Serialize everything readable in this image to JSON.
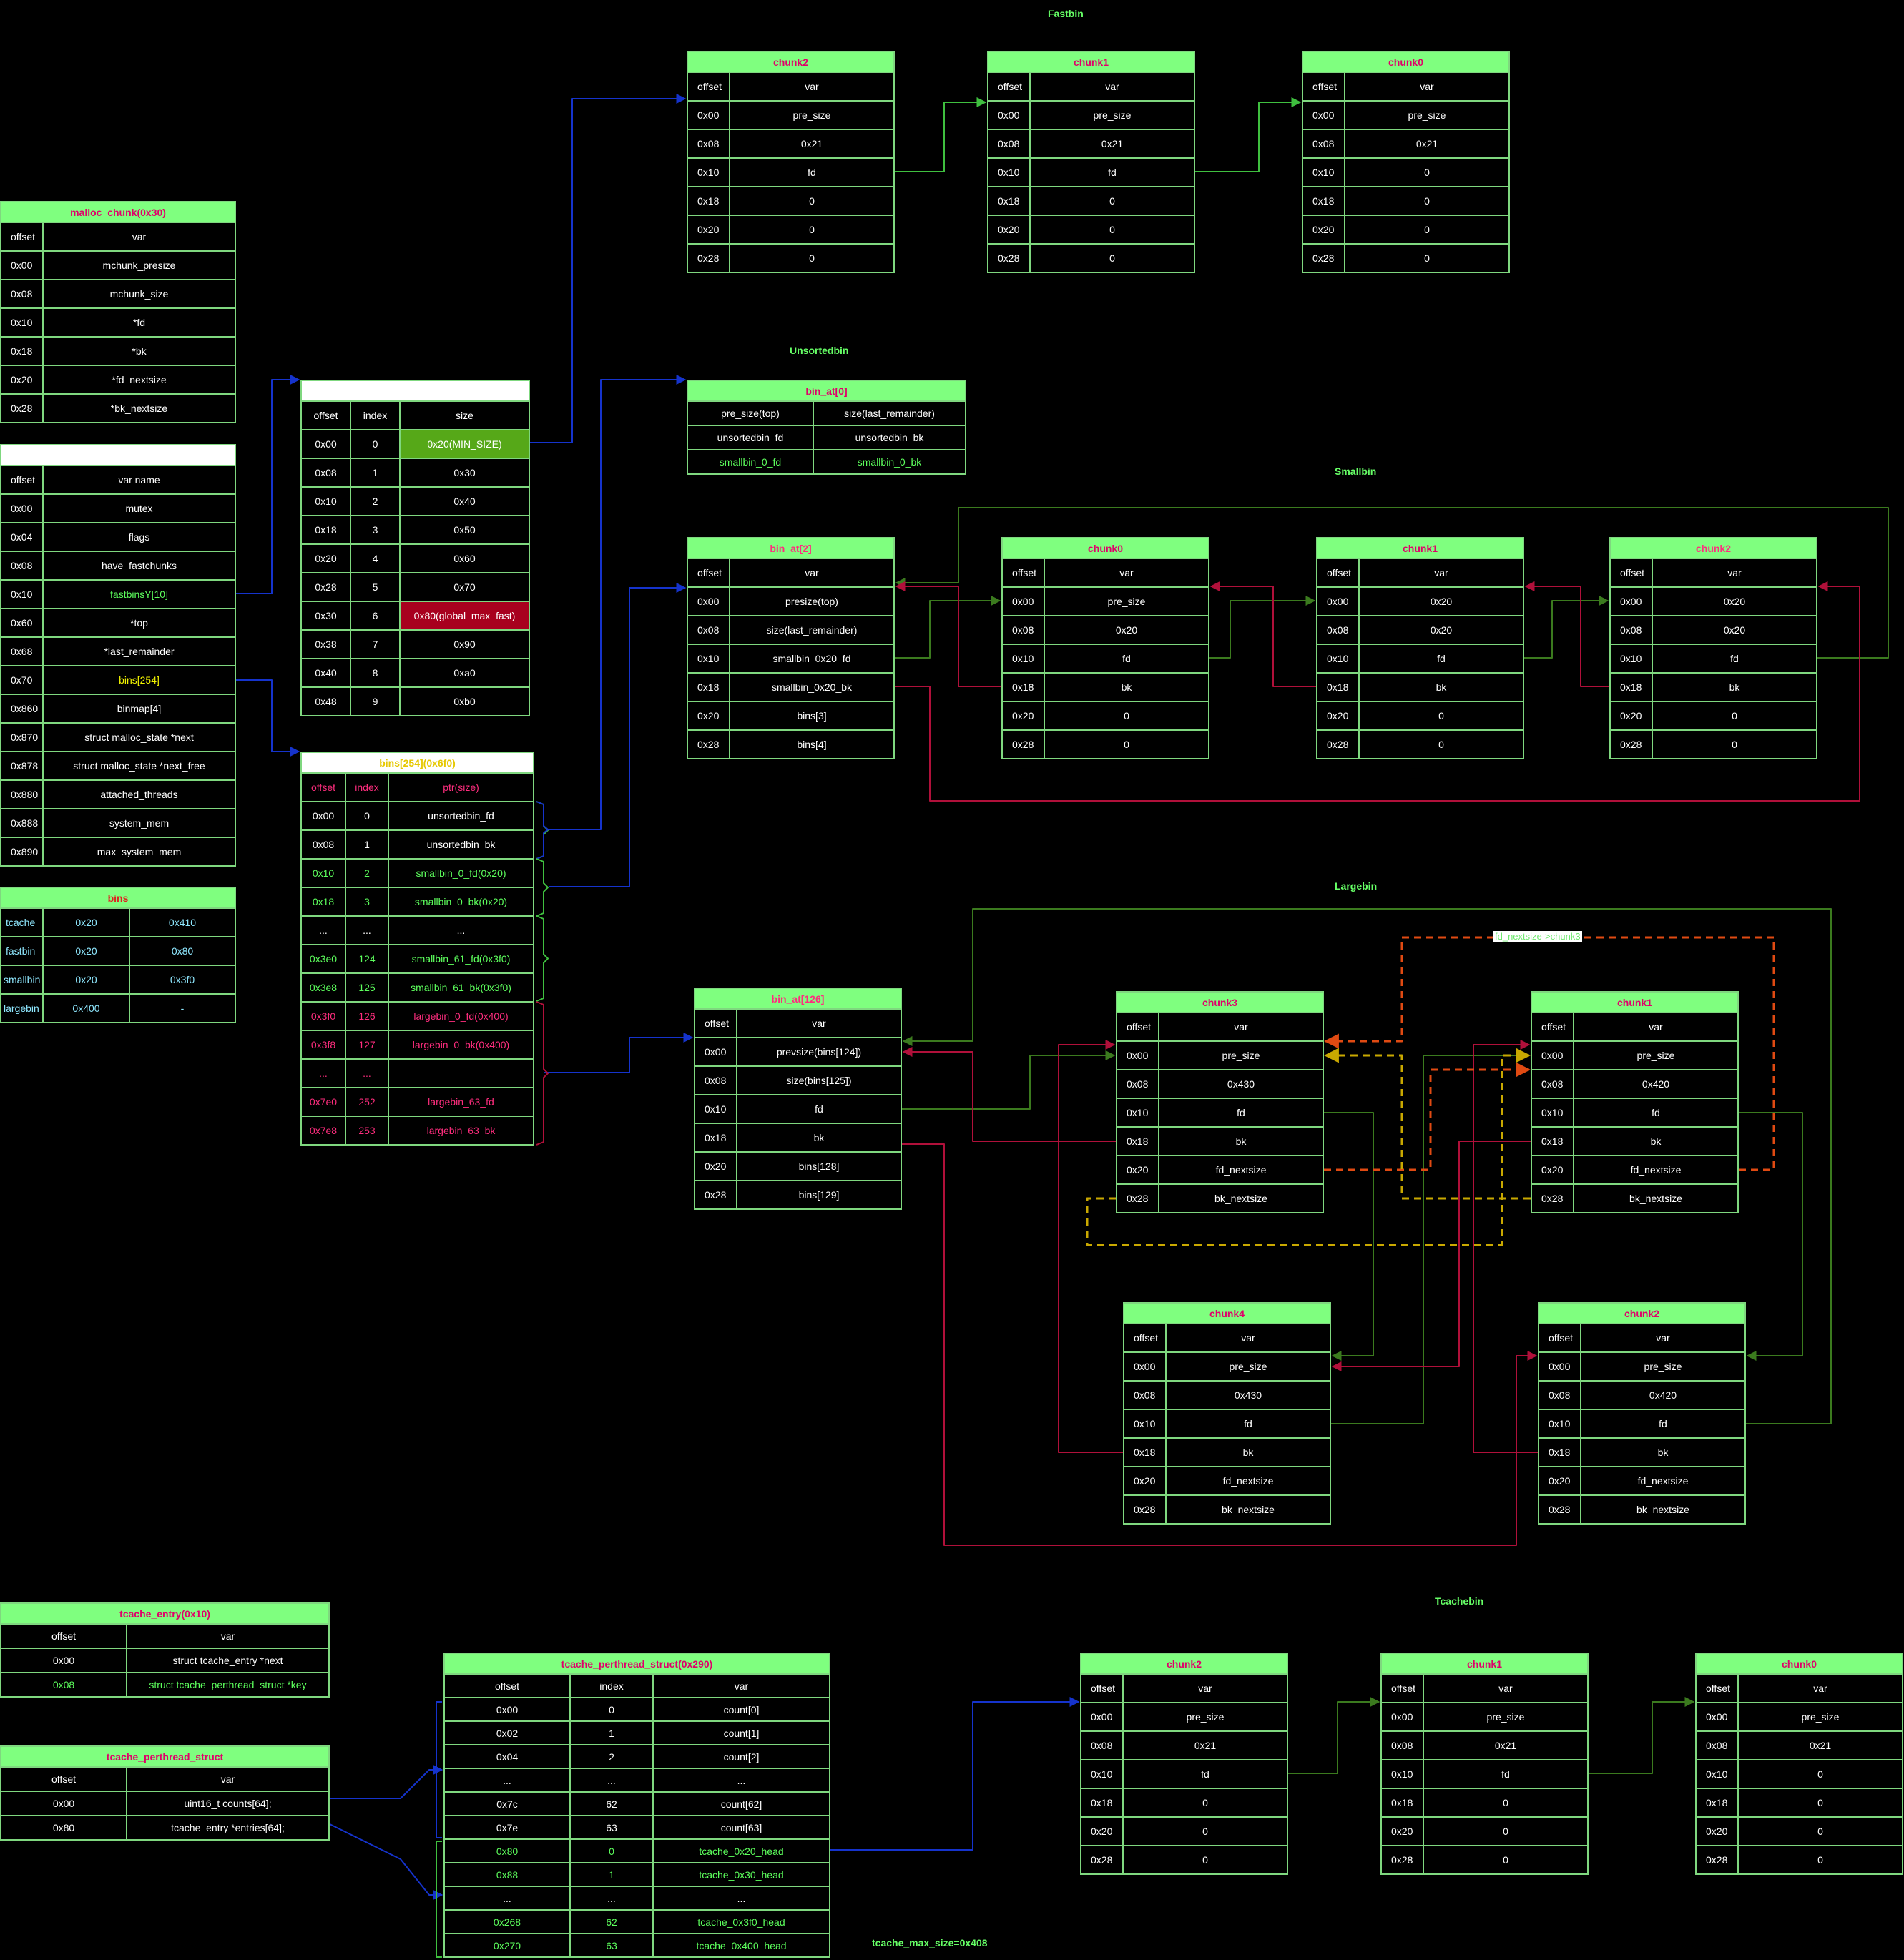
{
  "section_titles": {
    "fastbin": "Fastbin",
    "unsortedbin": "Unsortedbin",
    "smallbin": "Smallbin",
    "largebin": "Largebin",
    "tcachebin": "Tcachebin",
    "tcache_max_size": "tcache_max_size=0x408"
  },
  "notes": {
    "fd_nextsize_chunk3": "fd_nextsize->chunk3"
  },
  "malloc_chunk": {
    "title": "malloc_chunk(0x30)",
    "header": [
      "offset",
      "var"
    ],
    "rows": [
      [
        "0x00",
        "mchunk_presize"
      ],
      [
        "0x08",
        "mchunk_size"
      ],
      [
        "0x10",
        "*fd"
      ],
      [
        "0x18",
        "*bk"
      ],
      [
        "0x20",
        "*fd_nextsize"
      ],
      [
        "0x28",
        "*bk_nextsize"
      ]
    ]
  },
  "malloc_state": {
    "title": "",
    "header": [
      "offset",
      "var name"
    ],
    "rows": [
      [
        "0x00",
        "mutex"
      ],
      [
        "0x04",
        "flags"
      ],
      [
        "0x08",
        "have_fastchunks"
      ],
      [
        "0x10",
        "fastbinsY[10]"
      ],
      [
        "0x60",
        "*top"
      ],
      [
        "0x68",
        "*last_remainder"
      ],
      [
        "0x70",
        "bins[254]"
      ],
      [
        "0x860",
        "binmap[4]"
      ],
      [
        "0x870",
        "struct malloc_state *next"
      ],
      [
        "0x878",
        "struct malloc_state *next_free"
      ],
      [
        "0x880",
        "attached_threads"
      ],
      [
        "0x888",
        "system_mem"
      ],
      [
        "0x890",
        "max_system_mem"
      ]
    ]
  },
  "bins_summary": {
    "title": "bins",
    "rows": [
      [
        "tcache",
        "0x20",
        "0x410"
      ],
      [
        "fastbin",
        "0x20",
        "0x80"
      ],
      [
        "smallbin",
        "0x20",
        "0x3f0"
      ],
      [
        "largebin",
        "0x400",
        "-"
      ]
    ]
  },
  "fastbins_y": {
    "title": "",
    "header": [
      "offset",
      "index",
      "size"
    ],
    "rows": [
      [
        "0x00",
        "0",
        "0x20(MIN_SIZE)"
      ],
      [
        "0x08",
        "1",
        "0x30"
      ],
      [
        "0x10",
        "2",
        "0x40"
      ],
      [
        "0x18",
        "3",
        "0x50"
      ],
      [
        "0x20",
        "4",
        "0x60"
      ],
      [
        "0x28",
        "5",
        "0x70"
      ],
      [
        "0x30",
        "6",
        "0x80(global_max_fast)"
      ],
      [
        "0x38",
        "7",
        "0x90"
      ],
      [
        "0x40",
        "8",
        "0xa0"
      ],
      [
        "0x48",
        "9",
        "0xb0"
      ]
    ]
  },
  "bins_array": {
    "title": "bins[254](0x6f0)",
    "header": [
      "offset",
      "index",
      "ptr(size)"
    ],
    "rows": [
      [
        "0x00",
        "0",
        "unsortedbin_fd"
      ],
      [
        "0x08",
        "1",
        "unsortedbin_bk"
      ],
      [
        "0x10",
        "2",
        "smallbin_0_fd(0x20)"
      ],
      [
        "0x18",
        "3",
        "smallbin_0_bk(0x20)"
      ],
      [
        "...",
        "...",
        "..."
      ],
      [
        "0x3e0",
        "124",
        "smallbin_61_fd(0x3f0)"
      ],
      [
        "0x3e8",
        "125",
        "smallbin_61_bk(0x3f0)"
      ],
      [
        "0x3f0",
        "126",
        "largebin_0_fd(0x400)"
      ],
      [
        "0x3f8",
        "127",
        "largebin_0_bk(0x400)"
      ],
      [
        "...",
        "...",
        ""
      ],
      [
        "0x7e0",
        "252",
        "largebin_63_fd"
      ],
      [
        "0x7e8",
        "253",
        "largebin_63_bk"
      ]
    ]
  },
  "fast_chunks": [
    {
      "title": "chunk2",
      "rows": [
        [
          "0x00",
          "pre_size"
        ],
        [
          "0x08",
          "0x21"
        ],
        [
          "0x10",
          "fd"
        ],
        [
          "0x18",
          "0"
        ],
        [
          "0x20",
          "0"
        ],
        [
          "0x28",
          "0"
        ]
      ]
    },
    {
      "title": "chunk1",
      "rows": [
        [
          "0x00",
          "pre_size"
        ],
        [
          "0x08",
          "0x21"
        ],
        [
          "0x10",
          "fd"
        ],
        [
          "0x18",
          "0"
        ],
        [
          "0x20",
          "0"
        ],
        [
          "0x28",
          "0"
        ]
      ]
    },
    {
      "title": "chunk0",
      "rows": [
        [
          "0x00",
          "pre_size"
        ],
        [
          "0x08",
          "0x21"
        ],
        [
          "0x10",
          "0"
        ],
        [
          "0x18",
          "0"
        ],
        [
          "0x20",
          "0"
        ],
        [
          "0x28",
          "0"
        ]
      ]
    }
  ],
  "unsorted_bin_at": {
    "title": "bin_at[0]",
    "rows": [
      [
        "pre_size(top)",
        "size(last_remainder)"
      ],
      [
        "unsortedbin_fd",
        "unsortedbin_bk"
      ],
      [
        "smallbin_0_fd",
        "smallbin_0_bk"
      ]
    ]
  },
  "small_bin_at": {
    "title": "bin_at[2]",
    "rows": [
      [
        "0x00",
        "presize(top)"
      ],
      [
        "0x08",
        "size(last_remainder)"
      ],
      [
        "0x10",
        "smallbin_0x20_fd"
      ],
      [
        "0x18",
        "smallbin_0x20_bk"
      ],
      [
        "0x20",
        "bins[3]"
      ],
      [
        "0x28",
        "bins[4]"
      ]
    ]
  },
  "small_chunks": [
    {
      "title": "chunk0",
      "rows": [
        [
          "0x00",
          "pre_size"
        ],
        [
          "0x08",
          "0x20"
        ],
        [
          "0x10",
          "fd"
        ],
        [
          "0x18",
          "bk"
        ],
        [
          "0x20",
          "0"
        ],
        [
          "0x28",
          "0"
        ]
      ]
    },
    {
      "title": "chunk1",
      "rows": [
        [
          "0x00",
          "0x20"
        ],
        [
          "0x08",
          "0x20"
        ],
        [
          "0x10",
          "fd"
        ],
        [
          "0x18",
          "bk"
        ],
        [
          "0x20",
          "0"
        ],
        [
          "0x28",
          "0"
        ]
      ]
    },
    {
      "title": "chunk2",
      "rows": [
        [
          "0x00",
          "0x20"
        ],
        [
          "0x08",
          "0x20"
        ],
        [
          "0x10",
          "fd"
        ],
        [
          "0x18",
          "bk"
        ],
        [
          "0x20",
          "0"
        ],
        [
          "0x28",
          "0"
        ]
      ]
    }
  ],
  "large_bin_at": {
    "title": "bin_at[126]",
    "rows": [
      [
        "0x00",
        "prevsize(bins[124])"
      ],
      [
        "0x08",
        "size(bins[125])"
      ],
      [
        "0x10",
        "fd"
      ],
      [
        "0x18",
        "bk"
      ],
      [
        "0x20",
        "bins[128]"
      ],
      [
        "0x28",
        "bins[129]"
      ]
    ]
  },
  "large_chunks": {
    "chunk3": {
      "title": "chunk3",
      "rows": [
        [
          "0x00",
          "pre_size"
        ],
        [
          "0x08",
          "0x430"
        ],
        [
          "0x10",
          "fd"
        ],
        [
          "0x18",
          "bk"
        ],
        [
          "0x20",
          "fd_nextsize"
        ],
        [
          "0x28",
          "bk_nextsize"
        ]
      ]
    },
    "chunk1": {
      "title": "chunk1",
      "rows": [
        [
          "0x00",
          "pre_size"
        ],
        [
          "0x08",
          "0x420"
        ],
        [
          "0x10",
          "fd"
        ],
        [
          "0x18",
          "bk"
        ],
        [
          "0x20",
          "fd_nextsize"
        ],
        [
          "0x28",
          "bk_nextsize"
        ]
      ]
    },
    "chunk4": {
      "title": "chunk4",
      "rows": [
        [
          "0x00",
          "pre_size"
        ],
        [
          "0x08",
          "0x430"
        ],
        [
          "0x10",
          "fd"
        ],
        [
          "0x18",
          "bk"
        ],
        [
          "0x20",
          "fd_nextsize"
        ],
        [
          "0x28",
          "bk_nextsize"
        ]
      ]
    },
    "chunk2": {
      "title": "chunk2",
      "rows": [
        [
          "0x00",
          "pre_size"
        ],
        [
          "0x08",
          "0x420"
        ],
        [
          "0x10",
          "fd"
        ],
        [
          "0x18",
          "bk"
        ],
        [
          "0x20",
          "fd_nextsize"
        ],
        [
          "0x28",
          "bk_nextsize"
        ]
      ]
    }
  },
  "tcache_entry": {
    "title": "tcache_entry(0x10)",
    "header": [
      "offset",
      "var"
    ],
    "rows": [
      [
        "0x00",
        "struct tcache_entry *next"
      ],
      [
        "0x08",
        "struct tcache_perthread_struct *key"
      ]
    ]
  },
  "tcache_perthread": {
    "title": "tcache_perthread_struct",
    "header": [
      "offset",
      "var"
    ],
    "rows": [
      [
        "0x00",
        "uint16_t counts[64];"
      ],
      [
        "0x80",
        "tcache_entry *entries[64];"
      ]
    ]
  },
  "tcache_perthread_detail": {
    "title": "tcache_perthread_struct(0x290)",
    "header": [
      "offset",
      "index",
      "var"
    ],
    "rows": [
      [
        "0x00",
        "0",
        "count[0]"
      ],
      [
        "0x02",
        "1",
        "count[1]"
      ],
      [
        "0x04",
        "2",
        "count[2]"
      ],
      [
        "...",
        "...",
        "..."
      ],
      [
        "0x7c",
        "62",
        "count[62]"
      ],
      [
        "0x7e",
        "63",
        "count[63]"
      ],
      [
        "0x80",
        "0",
        "tcache_0x20_head"
      ],
      [
        "0x88",
        "1",
        "tcache_0x30_head"
      ],
      [
        "...",
        "...",
        "..."
      ],
      [
        "0x268",
        "62",
        "tcache_0x3f0_head"
      ],
      [
        "0x270",
        "63",
        "tcache_0x400_head"
      ]
    ]
  },
  "tcache_chunks": [
    {
      "title": "chunk2",
      "rows": [
        [
          "0x00",
          "pre_size"
        ],
        [
          "0x08",
          "0x21"
        ],
        [
          "0x10",
          "fd"
        ],
        [
          "0x18",
          "0"
        ],
        [
          "0x20",
          "0"
        ],
        [
          "0x28",
          "0"
        ]
      ]
    },
    {
      "title": "chunk1",
      "rows": [
        [
          "0x00",
          "pre_size"
        ],
        [
          "0x08",
          "0x21"
        ],
        [
          "0x10",
          "fd"
        ],
        [
          "0x18",
          "0"
        ],
        [
          "0x20",
          "0"
        ],
        [
          "0x28",
          "0"
        ]
      ]
    },
    {
      "title": "chunk0",
      "rows": [
        [
          "0x00",
          "pre_size"
        ],
        [
          "0x08",
          "0x21"
        ],
        [
          "0x10",
          "0"
        ],
        [
          "0x18",
          "0"
        ],
        [
          "0x20",
          "0"
        ],
        [
          "0x28",
          "0"
        ]
      ]
    }
  ],
  "chunk_header": [
    "offset",
    "var"
  ],
  "colors": {
    "grid_line": "#7fd77f",
    "header_fill": "#7fff7f",
    "title_pink": "#e0006a",
    "blue_arrow": "#1533cc",
    "green_arrow": "#3fbf3f",
    "dark_green_arrow": "#3b7a1e",
    "red_arrow": "#b0103a",
    "orange_dashed": "#e04a12",
    "yellow_dashed": "#c9a800"
  }
}
